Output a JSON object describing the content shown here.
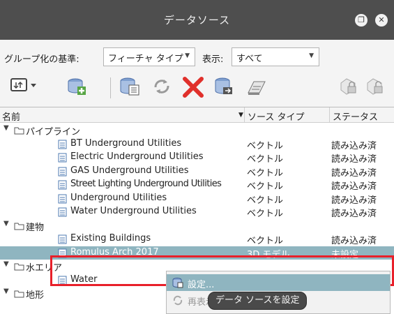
{
  "window": {
    "title": "データソース",
    "restore_label": "❐",
    "close_label": "✕"
  },
  "filter": {
    "group_label": "グループ化の基準:",
    "group_value": "フィーチャ タイプ",
    "display_label": "表示:",
    "display_value": "すべて"
  },
  "columns": {
    "name": "名前",
    "type": "ソース タイプ",
    "status": "ステータス",
    "sort_indicator": "▼"
  },
  "rows": [
    {
      "kind": "group",
      "name": "パイプライン"
    },
    {
      "kind": "item",
      "name": "BT Underground Utilities",
      "type": "ベクトル",
      "status": "読み込み済"
    },
    {
      "kind": "item",
      "name": "Electric Underground Utilities",
      "type": "ベクトル",
      "status": "読み込み済"
    },
    {
      "kind": "item",
      "name": "GAS Underground Utilities",
      "type": "ベクトル",
      "status": "読み込み済"
    },
    {
      "kind": "item",
      "name": "Street Lighting Underground Utilities",
      "type": "ベクトル",
      "status": "読み込み済"
    },
    {
      "kind": "item",
      "name": "Underground Utilities",
      "type": "ベクトル",
      "status": "読み込み済"
    },
    {
      "kind": "item",
      "name": "Water Underground Utilities",
      "type": "ベクトル",
      "status": "読み込み済"
    },
    {
      "kind": "group",
      "name": "建物"
    },
    {
      "kind": "item",
      "name": "Existing Buildings",
      "type": "ベクトル",
      "status": "読み込み済"
    },
    {
      "kind": "item",
      "name": "Romulus Arch 2017",
      "type": "3D モデル",
      "status": "未設定",
      "selected": true
    },
    {
      "kind": "group",
      "name": "水エリア"
    },
    {
      "kind": "item",
      "name": "Water",
      "type": "",
      "status": ""
    },
    {
      "kind": "group",
      "name": "地形"
    }
  ],
  "context_menu": {
    "items": [
      {
        "label": "設定..."
      },
      {
        "label": "再表示"
      }
    ]
  },
  "tooltip": "データ ソースを設定",
  "colors": {
    "titlebar": "#4e4e4e",
    "selection": "#8fb5c0",
    "highlight_border": "#e8202a",
    "delete_icon": "#e0302b",
    "add_icon": "#57a544"
  }
}
